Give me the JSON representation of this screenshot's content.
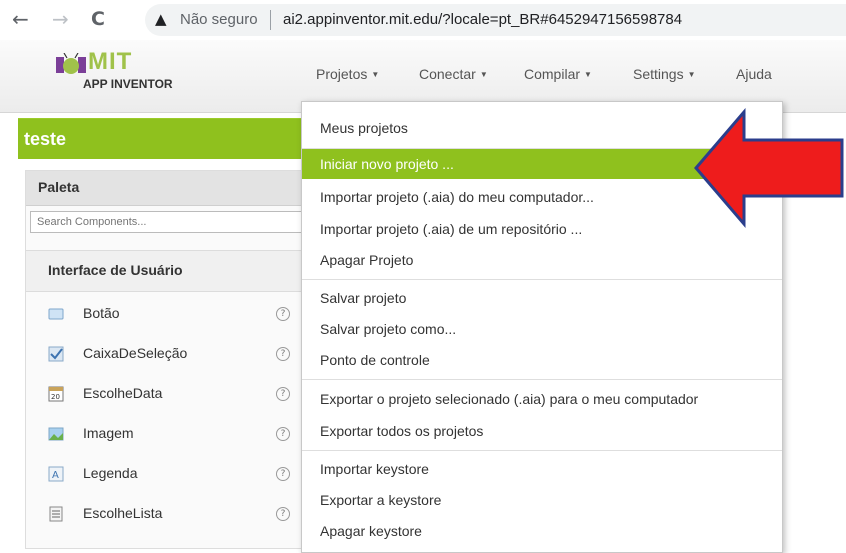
{
  "browser": {
    "back_icon": "←",
    "forward_icon": "→",
    "reload_icon": "C",
    "warning_icon": "▲",
    "security_label": "Não seguro",
    "url": "ai2.appinventor.mit.edu/?locale=pt_BR#6452947156598784"
  },
  "header": {
    "logo_title": "MIT",
    "logo_subtitle": "APP INVENTOR",
    "brand_color": "#a0c24a",
    "menus": [
      "Projetos",
      "Conectar",
      "Compilar",
      "Settings",
      "Ajuda"
    ]
  },
  "project": {
    "name": "teste",
    "bar_color": "#8fc11e"
  },
  "palette": {
    "title": "Paleta",
    "search_placeholder": "Search Components...",
    "category": "Interface de Usuário",
    "help_icon": "?",
    "components": [
      {
        "label": "Botão",
        "icon": "button-icon"
      },
      {
        "label": "CaixaDeSeleção",
        "icon": "checkbox-icon"
      },
      {
        "label": "EscolheData",
        "icon": "calendar-icon"
      },
      {
        "label": "Imagem",
        "icon": "image-icon"
      },
      {
        "label": "Legenda",
        "icon": "label-icon"
      },
      {
        "label": "EscolheLista",
        "icon": "list-icon"
      }
    ]
  },
  "projects_menu": {
    "highlight_color": "#8fc11e",
    "groups": [
      [
        "Meus projetos"
      ],
      [
        "Iniciar novo projeto ...",
        "Importar projeto (.aia) do meu computador...",
        "Importar projeto (.aia) de um repositório ...",
        "Apagar Projeto"
      ],
      [
        "Salvar projeto",
        "Salvar projeto como...",
        "Ponto de controle"
      ],
      [
        "Exportar o projeto selecionado (.aia) para o meu computador",
        "Exportar todos os projetos"
      ],
      [
        "Importar keystore",
        "Exportar a keystore",
        "Apagar keystore"
      ]
    ]
  },
  "annotation": {
    "color": "#ee1c1c",
    "outline": "#2b3e8c"
  }
}
